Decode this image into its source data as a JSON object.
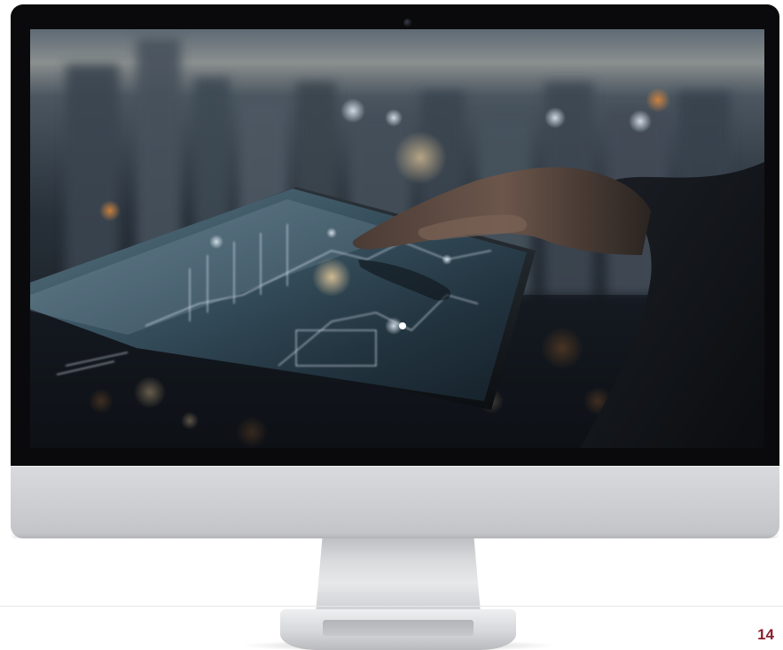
{
  "page": {
    "page_number": "14"
  },
  "monitor": {
    "screen_image": "photo-hand-touching-tablet-city-night",
    "icons": {
      "webcam": "webcam-icon"
    }
  },
  "colors": {
    "accent": "#8a1e2c",
    "bezel": "#0a0a0c",
    "chin": "#cfd0d3"
  }
}
